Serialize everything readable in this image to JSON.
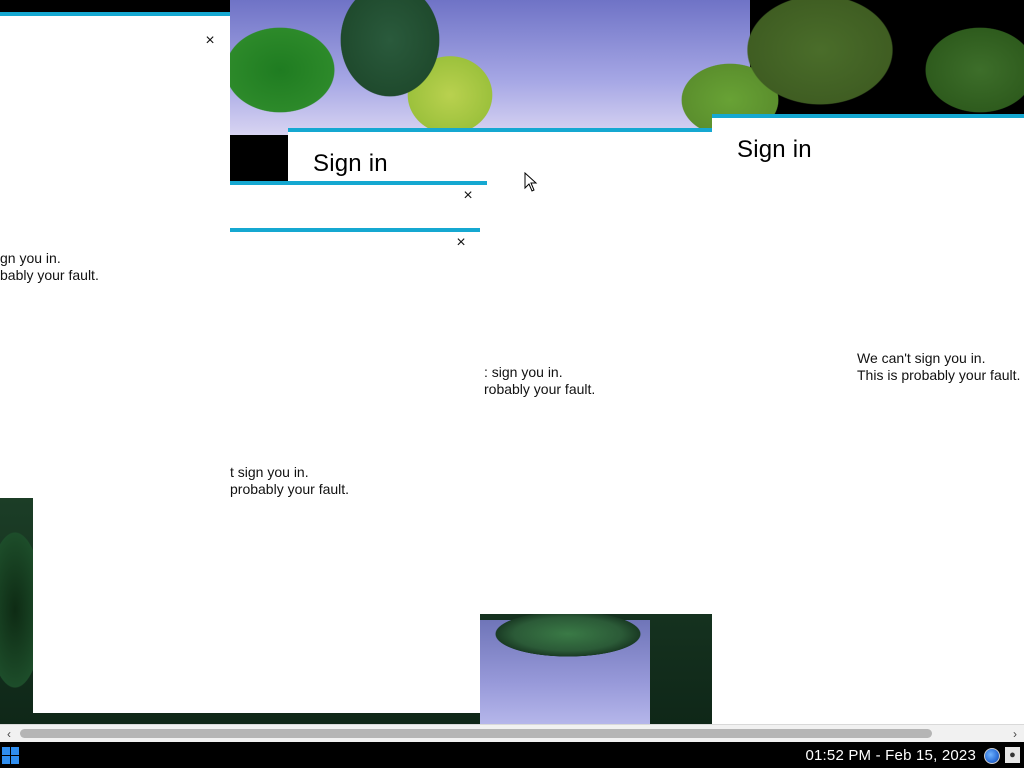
{
  "dialogs": {
    "title": "Sign in",
    "close_glyph": "×",
    "message_line1": "We can't sign you in.",
    "message_line2": "This is probably your fault.",
    "fragments": {
      "left_line1": "gn you in.",
      "left_line2": "bably your fault.",
      "middle_line1": ": sign you in.",
      "middle_line2": "robably your fault.",
      "lower_line1": "t sign you in.",
      "lower_line2": "probably your fault."
    }
  },
  "scrollbar": {
    "left_arrow": "‹",
    "right_arrow": "›"
  },
  "taskbar": {
    "datetime": "01:52 PM - Feb 15, 2023",
    "start_icon": "windows-start-icon",
    "tray_icons": [
      "globe-icon",
      "user-icon"
    ]
  },
  "colors": {
    "accent": "#15a8d1",
    "taskbar": "#000000"
  }
}
